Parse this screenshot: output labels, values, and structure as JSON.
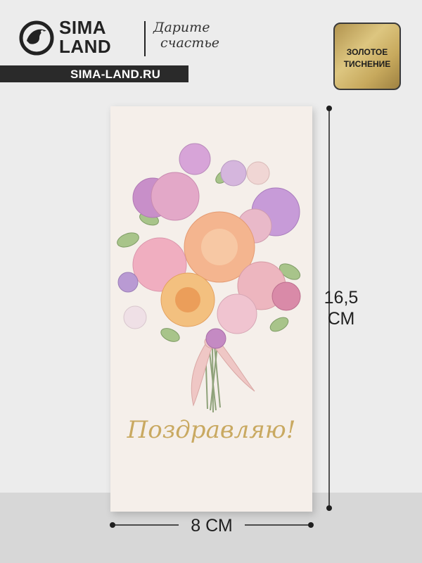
{
  "brand": {
    "name_line1": "SIMA",
    "name_line2": "LAND",
    "slogan_line1": "Дарите",
    "slogan_line2": "счастье",
    "url": "SIMA-LAND.RU"
  },
  "badge": {
    "line1": "ЗОЛОТОЕ",
    "line2": "ТИСНЕНИЕ"
  },
  "product": {
    "greeting": "Поздравляю!",
    "illustration": "flower-bouquet"
  },
  "dimensions": {
    "height_value": "16,5",
    "height_unit": "СМ",
    "width_label": "8 СМ"
  },
  "colors": {
    "gold": "#c9a961",
    "envelope": "#f5efea",
    "brand_dark": "#2a2a2a"
  }
}
